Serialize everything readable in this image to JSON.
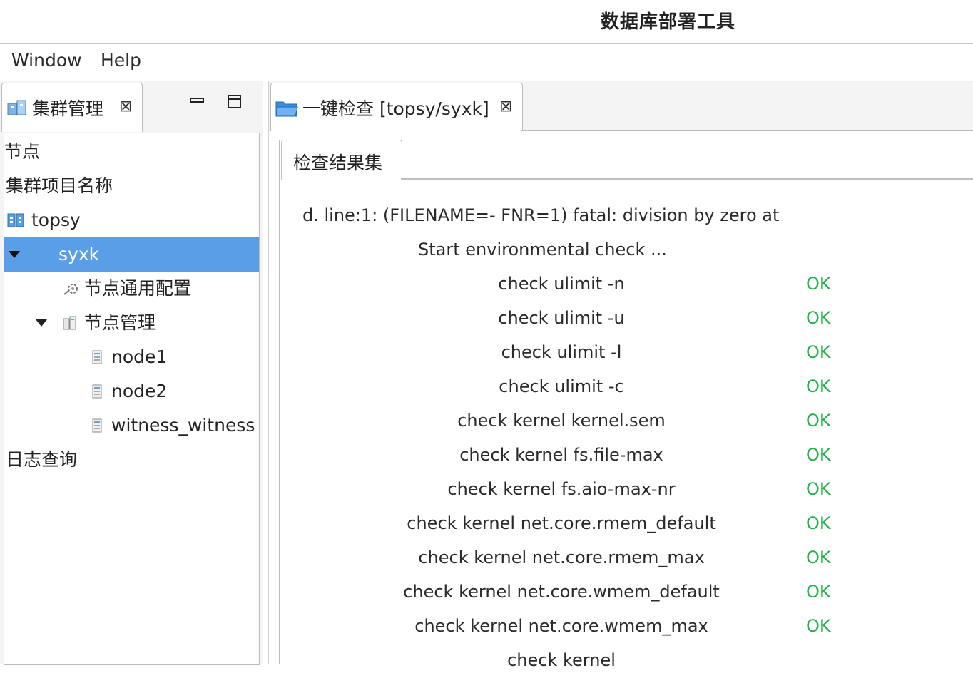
{
  "window": {
    "title": "数据库部署工具"
  },
  "menu": {
    "items": [
      "Window",
      "Help"
    ]
  },
  "left_view": {
    "tab_label": "集群管理",
    "close_glyph": "⊠",
    "minimize_icon": "minimize-icon",
    "maximize_icon": "maximize-icon",
    "tree": [
      {
        "label": "节点"
      },
      {
        "label": "集群项目名称"
      },
      {
        "label": "topsy"
      },
      {
        "label": "syxk"
      },
      {
        "label": "节点通用配置"
      },
      {
        "label": "节点管理"
      },
      {
        "label": "node1"
      },
      {
        "label": "node2"
      },
      {
        "label": "witness_witness"
      },
      {
        "label": "日志查询"
      }
    ]
  },
  "editor": {
    "tab_label": "一键检查 [topsy/syxk]",
    "close_glyph": "⊠",
    "inner_tab_label": "检查结果集",
    "lines": {
      "error": "d. line:1: (FILENAME=- FNR=1) fatal: division by zero at",
      "start": "Start environmental check ..."
    },
    "checks": [
      {
        "name": "check ulimit -n",
        "status": "OK"
      },
      {
        "name": "check ulimit -u",
        "status": "OK"
      },
      {
        "name": "check ulimit -l",
        "status": "OK"
      },
      {
        "name": "check ulimit -c",
        "status": "OK"
      },
      {
        "name": "check kernel kernel.sem",
        "status": "OK"
      },
      {
        "name": "check kernel fs.file-max",
        "status": "OK"
      },
      {
        "name": "check kernel fs.aio-max-nr",
        "status": "OK"
      },
      {
        "name": "check kernel net.core.rmem_default",
        "status": "OK"
      },
      {
        "name": "check kernel net.core.rmem_max",
        "status": "OK"
      },
      {
        "name": "check kernel net.core.wmem_default",
        "status": "OK"
      },
      {
        "name": "check kernel net.core.wmem_max",
        "status": "OK"
      },
      {
        "name": "check kernel",
        "status": ""
      }
    ]
  },
  "colors": {
    "selection": "#5b9ee8",
    "ok": "#22b24c"
  }
}
